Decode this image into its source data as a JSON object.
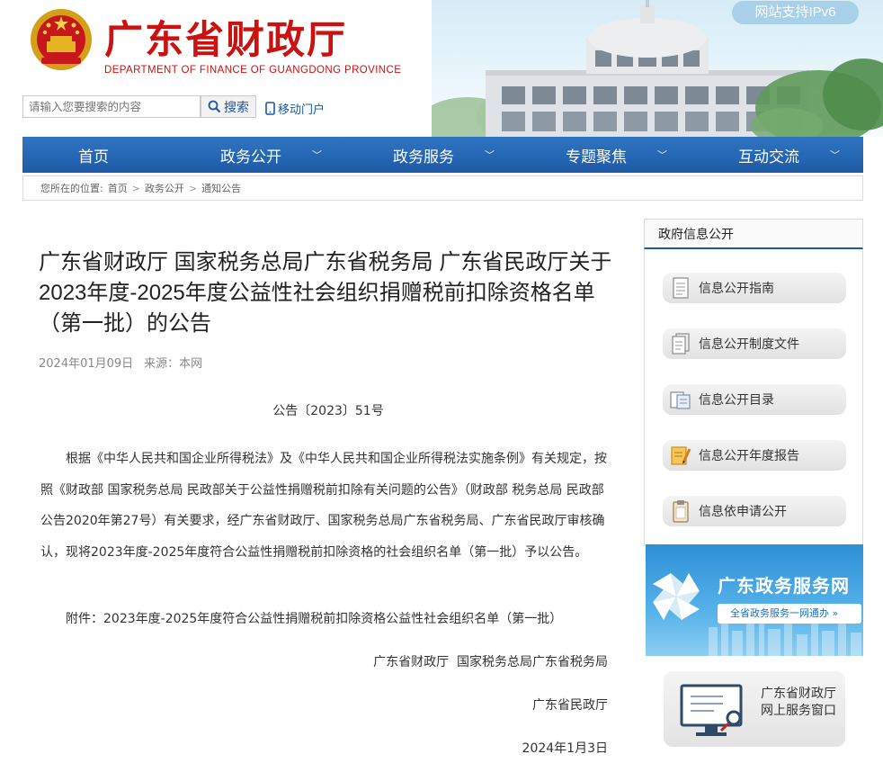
{
  "header": {
    "site_title": "广东省财政厅",
    "site_subtitle": "DEPARTMENT OF FINANCE OF GUANGDONG PROVINCE",
    "ipv6_badge": "网站支持IPv6",
    "search_placeholder": "请输入您要搜索的内容",
    "search_button": "搜索",
    "mobile_portal": "移动门户"
  },
  "nav": {
    "items": [
      {
        "label": "首页",
        "has_dropdown": false
      },
      {
        "label": "政务公开",
        "has_dropdown": true
      },
      {
        "label": "政务服务",
        "has_dropdown": true
      },
      {
        "label": "专题聚焦",
        "has_dropdown": true
      },
      {
        "label": "互动交流",
        "has_dropdown": true
      }
    ]
  },
  "breadcrumb": {
    "prefix": "您所在的位置:",
    "items": [
      "首页",
      "政务公开",
      "通知公告"
    ],
    "separator": ">"
  },
  "article": {
    "title": "广东省财政厅 国家税务总局广东省税务局 广东省民政厅关于2023年度-2025年度公益性社会组织捐赠税前扣除资格名单（第一批）的公告",
    "date": "2024年01月09日",
    "source": "来源：本网",
    "doc_number": "公告〔2023〕51号",
    "body": "根据《中华人民共和国企业所得税法》及《中华人民共和国企业所得税法实施条例》有关规定，按照《财政部 国家税务总局 民政部关于公益性捐赠税前扣除有关问题的公告》（财政部 税务总局 民政部公告2020年第27号）有关要求，经广东省财政厅、国家税务总局广东省税务局、广东省民政厅审核确认，现将2023年度-2025年度符合公益性捐赠税前扣除资格的社会组织名单（第一批）予以公告。",
    "attachment": "附件：2023年度-2025年度符合公益性捐赠税前扣除资格公益性社会组织名单（第一批）",
    "signature_line1": "广东省财政厅  国家税务总局广东省税务局",
    "signature_line2": "广东省民政厅",
    "signature_date": "2024年1月3日"
  },
  "sidebar": {
    "heading": "政府信息公开",
    "items": [
      {
        "label": "信息公开指南",
        "icon": "document-icon"
      },
      {
        "label": "信息公开制度文件",
        "icon": "files-icon"
      },
      {
        "label": "信息公开目录",
        "icon": "folder-icon"
      },
      {
        "label": "信息公开年度报告",
        "icon": "report-icon"
      },
      {
        "label": "信息依申请公开",
        "icon": "clipboard-icon"
      }
    ],
    "banner_service": {
      "title": "广东政务服务网",
      "subtitle": "全省政务服务一网通办 »"
    },
    "banner_window": {
      "text": "广东省财政厅网上服务窗口"
    }
  },
  "colors": {
    "brand_red": "#cc1111",
    "nav_blue": "#1e5aa6",
    "link_blue": "#1b57a6",
    "ipv6_bg": "#a8d0e8"
  }
}
